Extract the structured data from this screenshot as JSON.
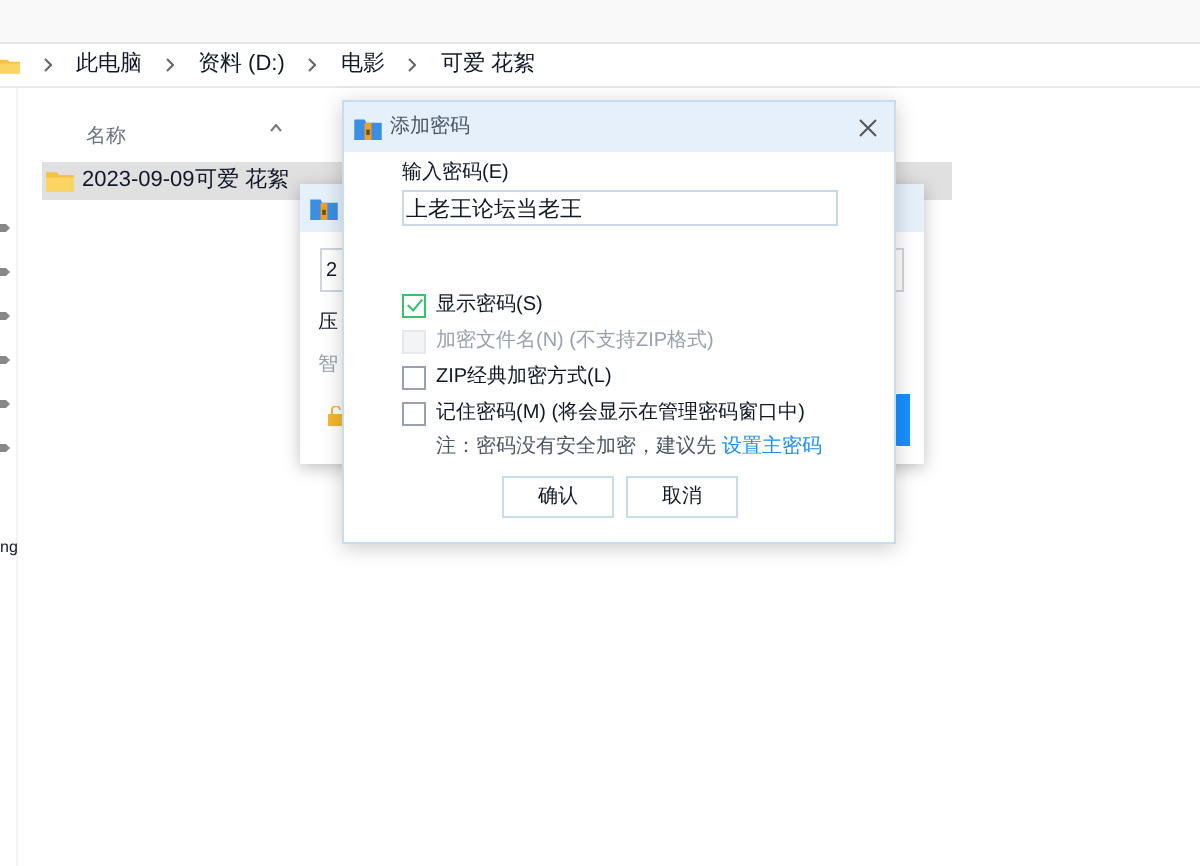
{
  "breadcrumb": [
    "此电脑",
    "资料 (D:)",
    "电影",
    "可爱 花絮"
  ],
  "file_list": {
    "column": "名称",
    "rows": [
      {
        "name": "2023-09-09可爱 花絮",
        "selected": true
      }
    ]
  },
  "nav_pane": {
    "cut_label": "ng"
  },
  "back_dialog": {
    "field_text": "2",
    "label_1": "压",
    "label_2": "智"
  },
  "dialog": {
    "title": "添加密码",
    "field_label": "输入密码(E)",
    "password": "上老王论坛当老王",
    "options": [
      {
        "label": "显示密码(S)",
        "checked": true,
        "disabled": false
      },
      {
        "label": "加密文件名(N) (不支持ZIP格式)",
        "checked": false,
        "disabled": true
      },
      {
        "label": "ZIP经典加密方式(L)",
        "checked": false,
        "disabled": false
      },
      {
        "label": "记住密码(M) (将会显示在管理密码窗口中)",
        "checked": false,
        "disabled": false
      }
    ],
    "note": "注：密码没有安全加密，建议先",
    "note_link": "设置主密码",
    "buttons": [
      "确认",
      "取消"
    ]
  }
}
